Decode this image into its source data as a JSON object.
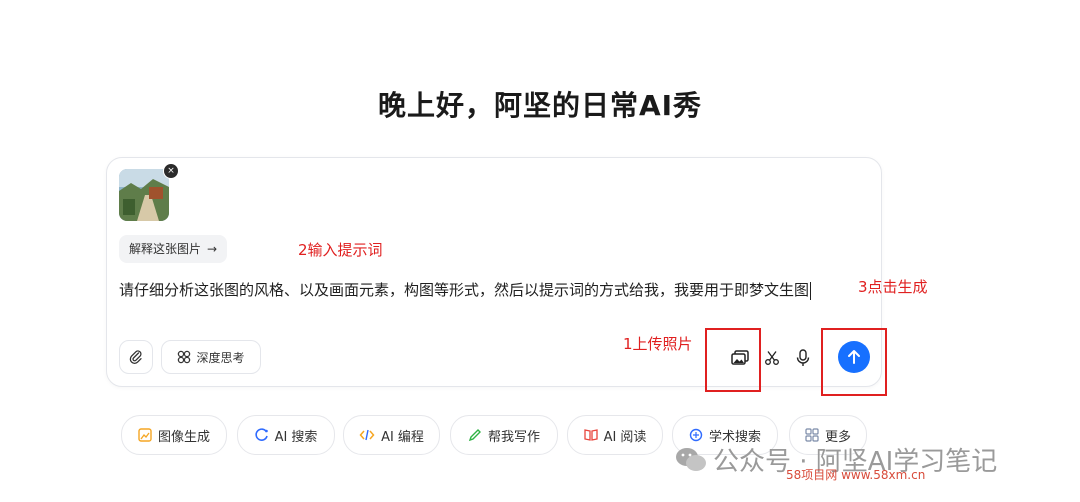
{
  "greeting": "晚上好，阿坚的日常AI秀",
  "attachment": {
    "close_label": "×"
  },
  "suggest_chip": {
    "label": "解释这张图片",
    "arrow": "→"
  },
  "prompt_text": "请仔细分析这张图的风格、以及画面元素，构图等形式，然后以提示词的方式给我，我要用于即梦文生图",
  "toolbar": {
    "deep_think_label": "深度思考",
    "icons": [
      "paperclip-icon",
      "deep-think-icon",
      "image-upload-icon",
      "scissors-icon",
      "microphone-icon",
      "send-arrow-icon"
    ]
  },
  "annotations": {
    "step1": "1上传照片",
    "step2": "2输入提示词",
    "step3": "3点击生成",
    "color": "#e02020"
  },
  "quick_actions": [
    {
      "label": "图像生成",
      "color": "#f5a623"
    },
    {
      "label": "AI 搜索",
      "color": "#2f6bff"
    },
    {
      "label": "AI 编程",
      "color": "#f5a623"
    },
    {
      "label": "帮我写作",
      "color": "#2fb344"
    },
    {
      "label": "AI 阅读",
      "color": "#e8453c"
    },
    {
      "label": "学术搜索",
      "color": "#2f6bff"
    },
    {
      "label": "更多",
      "color": "#7a8aa8"
    }
  ],
  "watermark": {
    "text": "公众号 · 阿坚AI学习笔记",
    "site": "58项目网 www.58xm.cn"
  },
  "colors": {
    "accent": "#1770ff",
    "border": "#e4e6eb",
    "annotation": "#e02020"
  }
}
